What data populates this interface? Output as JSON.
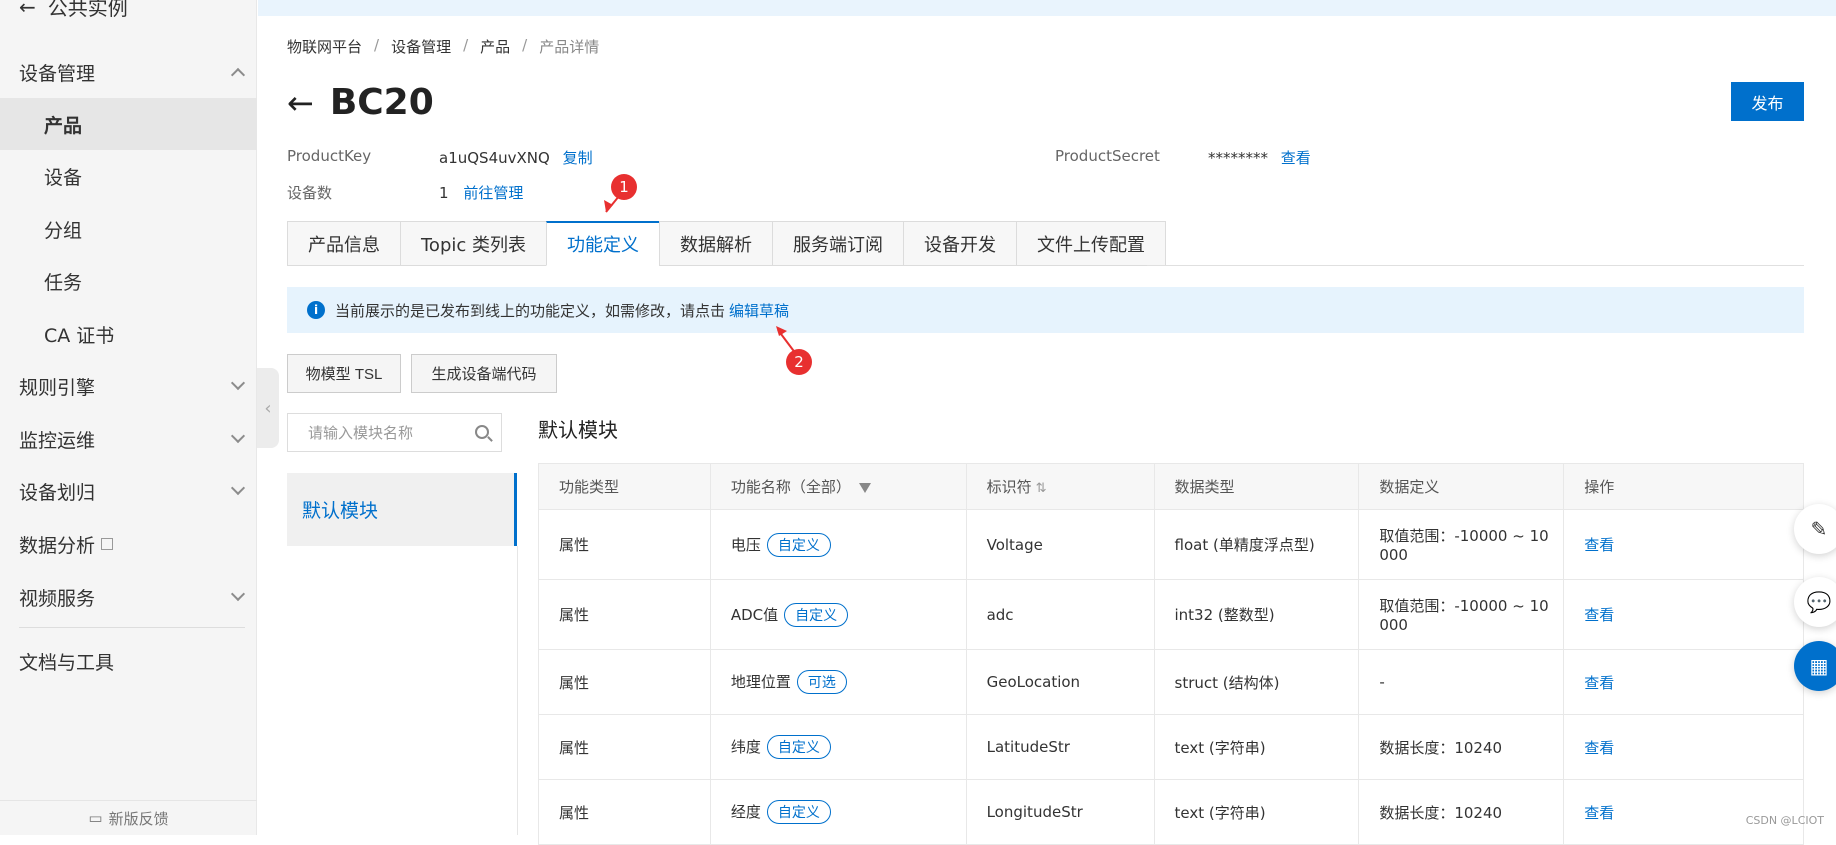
{
  "sidebar": {
    "top_label": "公共实例",
    "items": [
      {
        "label": "设备管理"
      },
      {
        "label": "产品"
      },
      {
        "label": "设备"
      },
      {
        "label": "分组"
      },
      {
        "label": "任务"
      },
      {
        "label": "CA 证书"
      },
      {
        "label": "规则引擎"
      },
      {
        "label": "监控运维"
      },
      {
        "label": "设备划归"
      },
      {
        "label": "数据分析"
      },
      {
        "label": "视频服务"
      },
      {
        "label": "文档与工具"
      }
    ],
    "feedback": "新版反馈"
  },
  "breadcrumb": [
    "物联网平台",
    "设备管理",
    "产品",
    "产品详情"
  ],
  "header": {
    "title": "BC20",
    "publish": "发布"
  },
  "meta": {
    "product_key_label": "ProductKey",
    "product_key_value": "a1uQS4uvXNQ",
    "copy": "复制",
    "device_count_label": "设备数",
    "device_count_value": "1",
    "manage": "前往管理",
    "secret_label": "ProductSecret",
    "secret_value": "********",
    "view": "查看"
  },
  "tabs": [
    "产品信息",
    "Topic 类列表",
    "功能定义",
    "数据解析",
    "服务端订阅",
    "设备开发",
    "文件上传配置"
  ],
  "notice": {
    "text": "当前展示的是已发布到线上的功能定义，如需修改，请点击",
    "link": "编辑草稿"
  },
  "buttons": {
    "tsl": "物模型 TSL",
    "gen_code": "生成设备端代码"
  },
  "module": {
    "search_placeholder": "请输入模块名称",
    "item": "默认模块",
    "section_title": "默认模块"
  },
  "table": {
    "headers": [
      "功能类型",
      "功能名称（全部）",
      "标识符",
      "数据类型",
      "数据定义",
      "操作"
    ],
    "rows": [
      {
        "type": "属性",
        "name": "电压",
        "tag": "自定义",
        "id": "Voltage",
        "dtype": "float (单精度浮点型)",
        "def1": "取值范围：-10000 ~ 10",
        "def2": "000",
        "op": "查看"
      },
      {
        "type": "属性",
        "name": "ADC值",
        "tag": "自定义",
        "id": "adc",
        "dtype": "int32 (整数型)",
        "def1": "取值范围：-10000 ~ 10",
        "def2": "000",
        "op": "查看"
      },
      {
        "type": "属性",
        "name": "地理位置",
        "tag": "可选",
        "id": "GeoLocation",
        "dtype": "struct (结构体)",
        "def1": "-",
        "def2": "",
        "op": "查看"
      },
      {
        "type": "属性",
        "name": "纬度",
        "tag": "自定义",
        "id": "LatitudeStr",
        "dtype": "text (字符串)",
        "def1": "数据长度：10240",
        "def2": "",
        "op": "查看"
      },
      {
        "type": "属性",
        "name": "经度",
        "tag": "自定义",
        "id": "LongitudeStr",
        "dtype": "text (字符串)",
        "def1": "数据长度：10240",
        "def2": "",
        "op": "查看"
      }
    ]
  },
  "annotations": [
    "1",
    "2"
  ],
  "watermark": "CSDN @LCIOT",
  "colors": {
    "accent": "#0070cc",
    "annotation": "#e83030",
    "notice_bg": "#e6f3fd"
  }
}
